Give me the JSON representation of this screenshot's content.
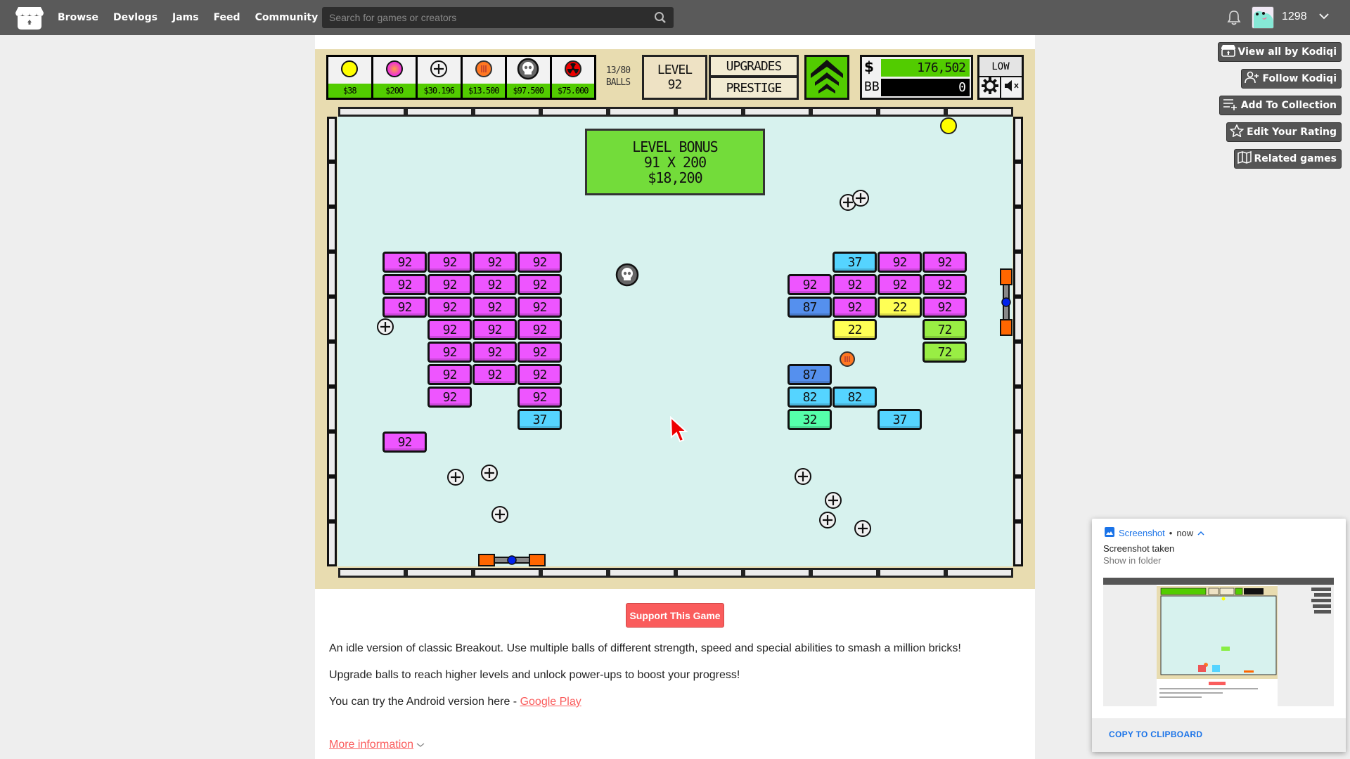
{
  "header": {
    "nav": [
      "Browse",
      "Devlogs",
      "Jams",
      "Feed",
      "Community"
    ],
    "search_placeholder": "Search for games or creators",
    "user_count": "1298"
  },
  "sidebar": {
    "buttons": [
      {
        "label": "View all by Kodiqi",
        "icon": "itchio-icon"
      },
      {
        "label": "Follow Kodiqi",
        "icon": "follow-user-icon"
      },
      {
        "label": "Add To Collection",
        "icon": "add-list-icon"
      },
      {
        "label": "Edit Your Rating",
        "icon": "star-icon"
      },
      {
        "label": "Related games",
        "icon": "map-icon"
      }
    ]
  },
  "game": {
    "shop": [
      {
        "ball": "basic-ball",
        "price": "$38",
        "color": "#ffff00"
      },
      {
        "ball": "plasma-ball",
        "price": "$200",
        "color": "#ee33ee"
      },
      {
        "ball": "plus-ball",
        "price": "$30.196",
        "color": "#f0f0f0"
      },
      {
        "ball": "cannon-ball",
        "price": "$13.500",
        "color": "#ff7722"
      },
      {
        "ball": "skull-ball",
        "price": "$97.500",
        "color": "#666666"
      },
      {
        "ball": "nuke-ball",
        "price": "$75.000",
        "color": "#ee0000"
      }
    ],
    "balls_count": "13/80",
    "balls_label": "BALLS",
    "level_label": "LEVEL",
    "level_value": "92",
    "upgrades_label": "UPGRADES",
    "prestige_label": "PRESTIGE",
    "money_symbol": "$",
    "money_value": "176,502",
    "bb_label": "BB",
    "bb_value": "0",
    "quality_label": "LOW",
    "bonus": {
      "line1": "LEVEL BONUS",
      "line2": "91 X 200",
      "line3": "$18,200"
    },
    "brick_colors": {
      "magenta": "#ee55ff",
      "cyan": "#55d4ff",
      "blue": "#5590ee",
      "yellow": "#ffff55",
      "lime": "#99ee44",
      "mint": "#55ffaa"
    },
    "bricks_left": [
      {
        "value": "92",
        "color": "magenta"
      },
      {
        "value": "92",
        "color": "magenta"
      },
      {
        "value": "92",
        "color": "magenta"
      },
      {
        "value": "92",
        "color": "magenta"
      },
      {
        "value": "92",
        "color": "magenta"
      },
      {
        "value": "92",
        "color": "magenta"
      },
      {
        "value": "92",
        "color": "magenta"
      },
      {
        "value": "92",
        "color": "magenta"
      },
      {
        "value": "92",
        "color": "magenta"
      },
      {
        "value": "92",
        "color": "magenta"
      },
      {
        "value": "92",
        "color": "magenta"
      },
      {
        "value": "92",
        "color": "magenta"
      },
      {
        "value": "92",
        "color": "magenta"
      },
      {
        "value": "92",
        "color": "magenta"
      },
      {
        "value": "92",
        "color": "magenta"
      },
      {
        "value": "92",
        "color": "magenta"
      },
      {
        "value": "92",
        "color": "magenta"
      },
      {
        "value": "92",
        "color": "magenta"
      },
      {
        "value": "92",
        "color": "magenta"
      },
      {
        "value": "92",
        "color": "magenta"
      },
      {
        "value": "92",
        "color": "magenta"
      },
      {
        "value": "92",
        "color": "magenta"
      },
      {
        "value": "92",
        "color": "magenta"
      },
      {
        "value": "37",
        "color": "cyan"
      },
      {
        "value": "92",
        "color": "magenta"
      }
    ],
    "bricks_right": [
      {
        "value": "37",
        "color": "cyan"
      },
      {
        "value": "92",
        "color": "magenta"
      },
      {
        "value": "92",
        "color": "magenta"
      },
      {
        "value": "92",
        "color": "magenta"
      },
      {
        "value": "92",
        "color": "magenta"
      },
      {
        "value": "92",
        "color": "magenta"
      },
      {
        "value": "92",
        "color": "magenta"
      },
      {
        "value": "87",
        "color": "blue"
      },
      {
        "value": "92",
        "color": "magenta"
      },
      {
        "value": "22",
        "color": "yellow"
      },
      {
        "value": "92",
        "color": "magenta"
      },
      {
        "value": "22",
        "color": "yellow"
      },
      {
        "value": "72",
        "color": "lime"
      },
      {
        "value": "72",
        "color": "lime"
      },
      {
        "value": "87",
        "color": "blue"
      },
      {
        "value": "82",
        "color": "cyan"
      },
      {
        "value": "82",
        "color": "cyan"
      },
      {
        "value": "32",
        "color": "mint"
      },
      {
        "value": "37",
        "color": "cyan"
      }
    ]
  },
  "description": {
    "support_label": "Support This Game",
    "p1": "An idle version of classic Breakout. Use multiple balls of different strength, speed and special abilities to smash a million bricks!",
    "p2": "Upgrade balls to reach higher levels and unlock power-ups to boost your progress!",
    "p3_prefix": "You can try the Android version here - ",
    "p3_link": "Google Play",
    "more_info": "More information"
  },
  "notification": {
    "app": "Screenshot",
    "time": "now",
    "title": "Screenshot taken",
    "subtitle": "Show in folder",
    "action": "COPY TO CLIPBOARD"
  }
}
